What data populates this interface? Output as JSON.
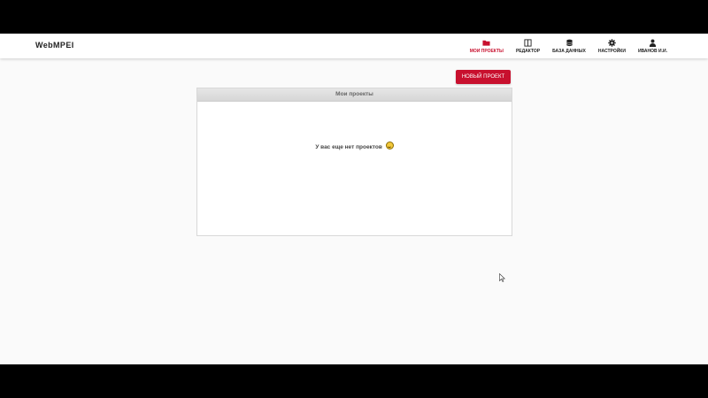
{
  "navbar": {
    "brand": "WebMPEI",
    "items": [
      {
        "label": "МОИ ПРОЕКТЫ",
        "icon": "folder-icon",
        "active": true
      },
      {
        "label": "РЕДАКТОР",
        "icon": "editor-icon",
        "active": false
      },
      {
        "label": "БАЗА ДАННЫХ",
        "icon": "database-icon",
        "active": false
      },
      {
        "label": "НАСТРОЙКИ",
        "icon": "gear-icon",
        "active": false
      },
      {
        "label": "ИВАНОВ И.И.",
        "icon": "user-icon",
        "active": false
      }
    ]
  },
  "actions": {
    "new_project_label": "НОВЫЙ ПРОЕКТ"
  },
  "projects_panel": {
    "title": "Мои проекты",
    "empty_message": "У вас еще нет проектов"
  },
  "colors": {
    "accent": "#c8102e",
    "background": "#fafafa",
    "letterbox": "#000000"
  }
}
